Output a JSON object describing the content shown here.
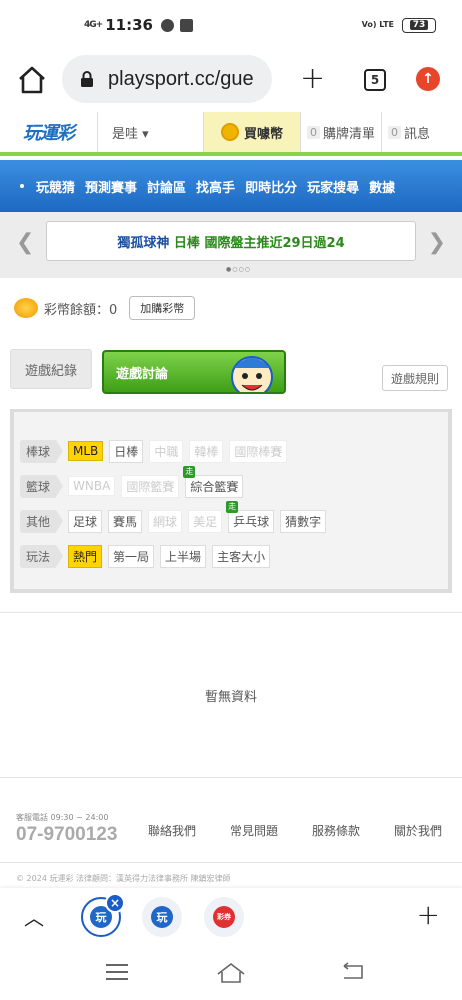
{
  "status_bar": {
    "signal": "4G+",
    "time": "11:36",
    "network": "Vo) LTE",
    "battery": "73"
  },
  "browser": {
    "url": "playsport.cc/gue",
    "tab_count": "5"
  },
  "site_header": {
    "logo": "玩運彩",
    "user": "是哇 ▾",
    "buy_coin": "買噱幣",
    "purchase_list_count": "0",
    "purchase_list": "購牌清單",
    "messages_count": "0",
    "messages": "訊息"
  },
  "nav": {
    "items": [
      "玩競猜",
      "預測賽事",
      "討論區",
      "找高手",
      "即時比分",
      "玩家搜尋",
      "數據"
    ]
  },
  "banner": {
    "text_a": "獨孤球神",
    "text_b": "日棒",
    "text_c": "國際盤主推近29日過24",
    "pager": "●○○○"
  },
  "balance": {
    "label": "彩幣餘額：0",
    "add_button": "加購彩幣"
  },
  "game_tabs": {
    "record": "遊戲紀錄",
    "discussion": "遊戲討論",
    "rules": "遊戲規則"
  },
  "filters": {
    "rows": [
      {
        "label": "棒球",
        "chips": [
          {
            "text": "MLB",
            "state": "active"
          },
          {
            "text": "日棒",
            "state": "normal"
          },
          {
            "text": "中職",
            "state": "disabled"
          },
          {
            "text": "韓棒",
            "state": "disabled"
          },
          {
            "text": "國際棒賽",
            "state": "disabled"
          }
        ]
      },
      {
        "label": "籃球",
        "chips": [
          {
            "text": "WNBA",
            "state": "disabled"
          },
          {
            "text": "國際籃賽",
            "state": "disabled"
          },
          {
            "text": "綜合籃賽",
            "state": "normal",
            "badge": "走"
          }
        ]
      },
      {
        "label": "其他",
        "chips": [
          {
            "text": "足球",
            "state": "normal"
          },
          {
            "text": "賽馬",
            "state": "normal"
          },
          {
            "text": "網球",
            "state": "disabled"
          },
          {
            "text": "美足",
            "state": "disabled"
          },
          {
            "text": "乒乓球",
            "state": "normal",
            "badge": "走"
          },
          {
            "text": "猜數字",
            "state": "normal"
          }
        ]
      },
      {
        "label": "玩法",
        "chips": [
          {
            "text": "熱門",
            "state": "active"
          },
          {
            "text": "第一局",
            "state": "normal"
          },
          {
            "text": "上半場",
            "state": "normal"
          },
          {
            "text": "主客大小",
            "state": "normal"
          }
        ]
      }
    ]
  },
  "results": {
    "empty_text": "暫無資料"
  },
  "footer": {
    "service_label": "客服電話 09:30 ~ 24:00",
    "phone": "07-9700123",
    "links": [
      "聯絡我們",
      "常見問題",
      "服務條款",
      "關於我們"
    ],
    "copyright": "© 2024 玩運彩 法律顧問：漢英得力法律事務所 陳鎮宏律師"
  },
  "tab_strip": {
    "tab1_icon": "玩",
    "tab2_icon": "玩",
    "tab3_icon": "彩券"
  },
  "colors": {
    "nav_blue": "#1d68c2",
    "accent_green": "#8bd14b",
    "chip_active": "#ffd400"
  }
}
